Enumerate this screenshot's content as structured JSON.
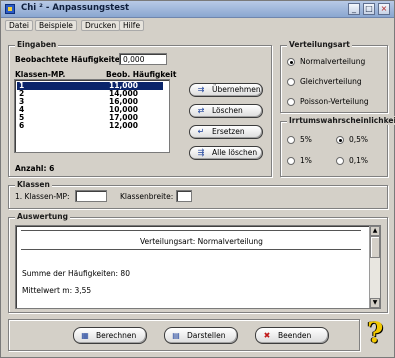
{
  "window": {
    "title": "Chi ² - Anpassungstest"
  },
  "menu": [
    {
      "label": "Datei"
    },
    {
      "label": "Beispiele"
    },
    {
      "label": "Drucken"
    },
    {
      "label": "Hilfe"
    }
  ],
  "eingaben": {
    "legend": "Eingaben",
    "freq_label": "Beobachtete Häufigkeiten:",
    "freq_value": "0,000",
    "col_class": "Klassen-MP.",
    "col_freq": "Beob. Häufigkeit",
    "rows": [
      {
        "mp": "1",
        "h": "11,000"
      },
      {
        "mp": "2",
        "h": "14,000"
      },
      {
        "mp": "3",
        "h": "16,000"
      },
      {
        "mp": "4",
        "h": "10,000"
      },
      {
        "mp": "5",
        "h": "17,000"
      },
      {
        "mp": "6",
        "h": "12,000"
      }
    ],
    "count_label": "Anzahl: 6",
    "buttons": {
      "uebernehmen": "Übernehmen",
      "loeschen": "Löschen",
      "ersetzen": "Ersetzen",
      "alle": "Alle löschen"
    }
  },
  "verteilungsart": {
    "legend": "Verteilungsart",
    "options": [
      "Normalverteilung",
      "Gleichverteilung",
      "Poisson-Verteilung"
    ],
    "selected": 0
  },
  "irrtum": {
    "legend": "Irrtumswahrscheinlichkeit",
    "options": [
      "5%",
      "0,5%",
      "1%",
      "0,1%"
    ],
    "selected": 1
  },
  "klassen": {
    "legend": "Klassen",
    "first_label": "1. Klassen-MP:",
    "first_value": "",
    "width_label": "Klassenbreite:",
    "width_value": ""
  },
  "auswertung": {
    "legend": "Auswertung",
    "line1": "Verteilungsart:   Normalverteilung",
    "line2": "Summe der Häufigkeiten:  80",
    "line3": "Mittelwert m:  3,55"
  },
  "footer": {
    "berechnen": "Berechnen",
    "darstellen": "Darstellen",
    "beenden": "Beenden"
  }
}
